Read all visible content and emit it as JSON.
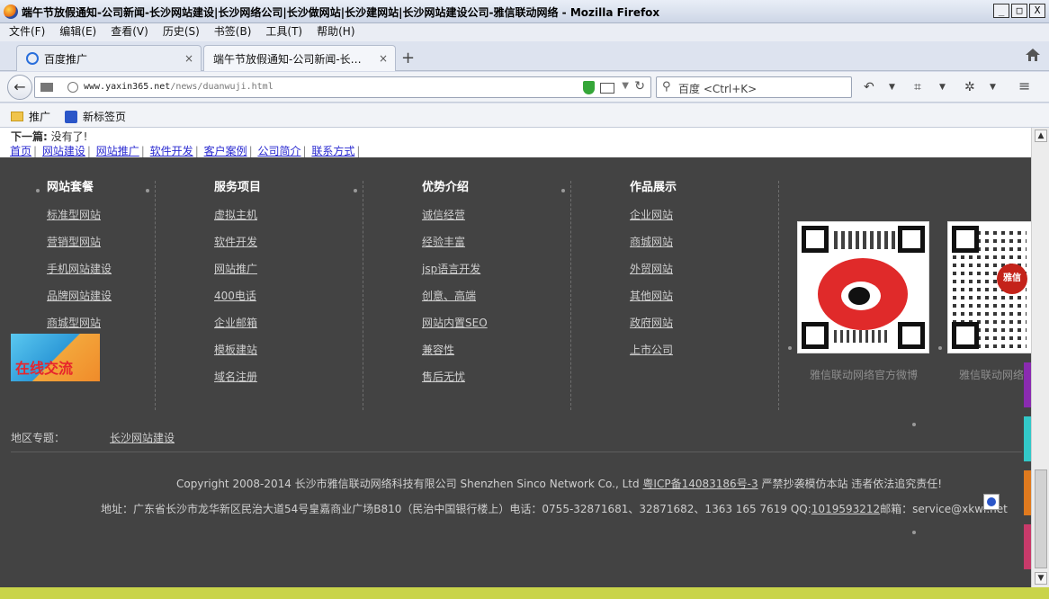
{
  "window": {
    "title": "端午节放假通知-公司新闻-长沙网站建设|长沙网络公司|长沙做网站|长沙建网站|长沙网站建设公司-雅信联动网络 - Mozilla Firefox",
    "buttons": [
      "_",
      "□",
      "X"
    ]
  },
  "menu": [
    "文件(F)",
    "编辑(E)",
    "查看(V)",
    "历史(S)",
    "书签(B)",
    "工具(T)",
    "帮助(H)"
  ],
  "tabs": [
    {
      "label": "百度推广",
      "close": "×"
    },
    {
      "label": "端午节放假通知-公司新闻-长…",
      "close": "×"
    }
  ],
  "newtab": "+",
  "nav": {
    "url_host": "www.yaxin365.net",
    "url_path": "/news/duanwuji.html",
    "search_placeholder": "百度 <Ctrl+K>"
  },
  "bookmarks": [
    "推广",
    "新标签页"
  ],
  "page": {
    "next_label": "下一篇:",
    "next_value": "没有了!",
    "toplinks": [
      "首页",
      "网站建设",
      "网站推广",
      "软件开发",
      "客户案例",
      "公司简介",
      "联系方式"
    ],
    "columns": [
      {
        "head": "网站套餐",
        "links": [
          "标准型网站",
          "营销型网站",
          "手机网站建设",
          "品牌网站建设",
          "商城型网站"
        ]
      },
      {
        "head": "服务项目",
        "links": [
          "虚拟主机",
          "软件开发",
          "网站推广",
          "400电话",
          "企业邮箱",
          "模板建站",
          "域名注册"
        ]
      },
      {
        "head": "优势介绍",
        "links": [
          "诚信经营",
          "经验丰富",
          "jsp语言开发",
          "创意、高端",
          "网站内置SEO",
          "兼容性",
          "售后无忧"
        ]
      },
      {
        "head": "作品展示",
        "links": [
          "企业网站",
          "商城网站",
          "外贸网站",
          "其他网站",
          "政府网站",
          "上市公司"
        ]
      }
    ],
    "online_chat": "在线交流",
    "qr_badge": "雅信",
    "qr_captions": [
      "雅信联动网络官方微博",
      "雅信联动网络"
    ],
    "region_label": "地区专题：",
    "region_link": "长沙网站建设",
    "copyright": "Copyright 2008-2014 长沙市雅信联动网络科技有限公司 Shenzhen Sinco Network Co., Ltd ",
    "icp": "粤ICP备14083186号-3",
    "copyright_tail": " 严禁抄袭模仿本站 违者依法追究责任!",
    "address": "地址：广东省长沙市龙华新区民治大道54号皇嘉商业广场B810（民治中国银行楼上）电话：0755-32871681、32871682、1363 165 7619 QQ:",
    "qq": "1019593212",
    "email": "邮箱：service@xkwl.net"
  },
  "colors": {
    "footer_bg": "#434343",
    "link_blue": "#2a2ad0",
    "side_tabs": [
      "#8a2bb0",
      "#32c8c8",
      "#e07a1e",
      "#c83a6a"
    ]
  }
}
